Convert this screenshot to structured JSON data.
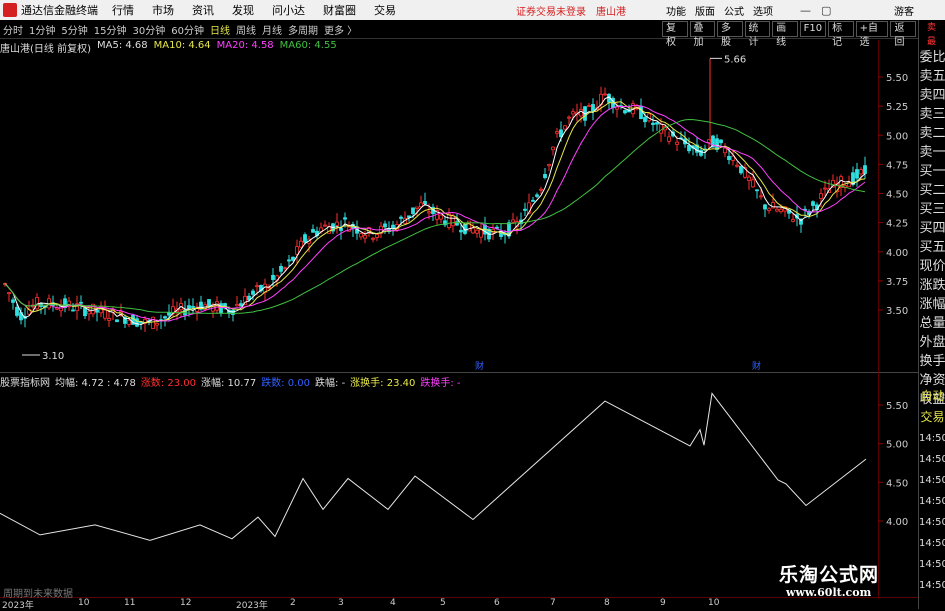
{
  "app": {
    "title": "通达信金融终端",
    "menu": [
      "行情",
      "市场",
      "资讯",
      "发现",
      "问小达",
      "财富圈",
      "交易"
    ],
    "notice": "证券交易未登录",
    "stock_name_top": "唐山港",
    "right_menu": [
      "功能",
      "版面",
      "公式",
      "选项"
    ],
    "guest": "游客"
  },
  "toolbar": {
    "periods": [
      "分时",
      "1分钟",
      "5分钟",
      "15分钟",
      "30分钟",
      "60分钟",
      "日线",
      "周线",
      "月线",
      "多周期",
      "更多 〉"
    ],
    "active_period": "日线",
    "tools": [
      "复权",
      "叠加",
      "多股",
      "统计",
      "画线",
      "F10",
      "标记",
      "+自选",
      "返回"
    ]
  },
  "kline_info": {
    "name": "唐山港(日线 前复权)",
    "ma5": "MA5: 4.68",
    "ma10": "MA10: 4.64",
    "ma20": "MA20: 4.58",
    "ma60": "MA60: 4.55",
    "high_label": "5.66",
    "low_label": "3.10"
  },
  "price_axis": [
    "5.50",
    "5.25",
    "5.00",
    "4.75",
    "4.50",
    "4.25",
    "4.00",
    "3.75",
    "3.50"
  ],
  "indicator_info": {
    "name": "股票指标网",
    "avg": "均幅: 4.72 : 4.78",
    "up_count": "涨数: 23.00",
    "up_amp": "涨幅: 10.77",
    "down_count": "跌数: 0.00",
    "down_amp": "跌幅: -",
    "up_turn": "涨换手: 23.40",
    "down_turn": "跌换手: -"
  },
  "ind_axis": [
    "5.50",
    "5.00",
    "4.50",
    "4.00"
  ],
  "side_panel": {
    "top": [
      "卖",
      "最"
    ],
    "items": [
      "委比",
      "卖五",
      "卖四",
      "卖三",
      "卖二",
      "卖一",
      "买一",
      "买二",
      "买三",
      "买四",
      "买五",
      "现价",
      "涨跌",
      "涨幅",
      "总量",
      "外盘",
      "换手",
      "净资",
      "收益"
    ],
    "lower": [
      "自动",
      "交易",
      "14:50",
      "14:50",
      "14:50",
      "14:50",
      "14:50",
      "14:50",
      "14:50",
      "14:50"
    ]
  },
  "dates": [
    "2023年",
    "10",
    "11",
    "12",
    "2023年",
    "2",
    "3",
    "4",
    "5",
    "6",
    "7",
    "8",
    "9",
    "10"
  ],
  "markers": [
    "财",
    "财"
  ],
  "footnote": "周期到未来数据",
  "watermark": {
    "title": "乐淘公式网",
    "url": "www.60lt.com"
  },
  "colors": {
    "ma5": "#ffffff",
    "ma10": "#e8e84a",
    "ma20": "#ff40ff",
    "ma60": "#40c040",
    "up": "#ff3030",
    "down": "#30e0e0"
  }
}
